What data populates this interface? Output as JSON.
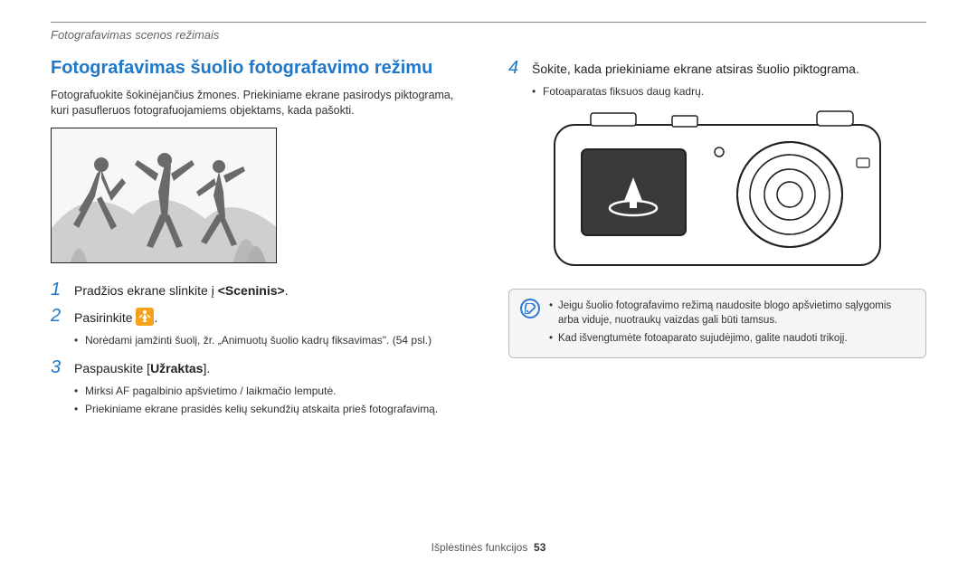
{
  "header": {
    "breadcrumb": "Fotografavimas scenos režimais"
  },
  "left": {
    "title": "Fotografavimas šuolio fotografavimo režimu",
    "intro": "Fotografuokite šokinėjančius žmones. Priekiniame ekrane pasirodys piktograma, kuri pasufleruos fotografuojamiems objektams, kada pašokti.",
    "steps": {
      "s1": {
        "num": "1",
        "pre": "Pradžios ekrane slinkite į ",
        "bold": "<Sceninis>",
        "post": "."
      },
      "s2": {
        "num": "2",
        "pre": "Pasirinkite ",
        "post": "."
      },
      "s2_sub1": "Norėdami įamžinti šuolį, žr. „Animuotų šuolio kadrų fiksavimas\". (54 psl.)",
      "s3": {
        "num": "3",
        "pre": "Paspauskite [",
        "bold": "Užraktas",
        "post": "]."
      },
      "s3_sub1": "Mirksi AF pagalbinio apšvietimo / laikmačio lemputė.",
      "s3_sub2": "Priekiniame ekrane prasidės kelių sekundžių atskaita prieš fotografavimą."
    }
  },
  "right": {
    "s4": {
      "num": "4",
      "text": "Šokite, kada priekiniame ekrane atsiras šuolio piktograma."
    },
    "s4_sub1": "Fotoaparatas fiksuos daug kadrų.",
    "note1": "Jeigu šuolio fotografavimo režimą naudosite blogo apšvietimo sąlygomis arba viduje, nuotraukų vaizdas gali būti tamsus.",
    "note2": "Kad išvengtumėte fotoaparato sujudėjimo, galite naudoti trikojį."
  },
  "footer": {
    "label": "Išplėstinės funkcijos",
    "page": "53"
  }
}
